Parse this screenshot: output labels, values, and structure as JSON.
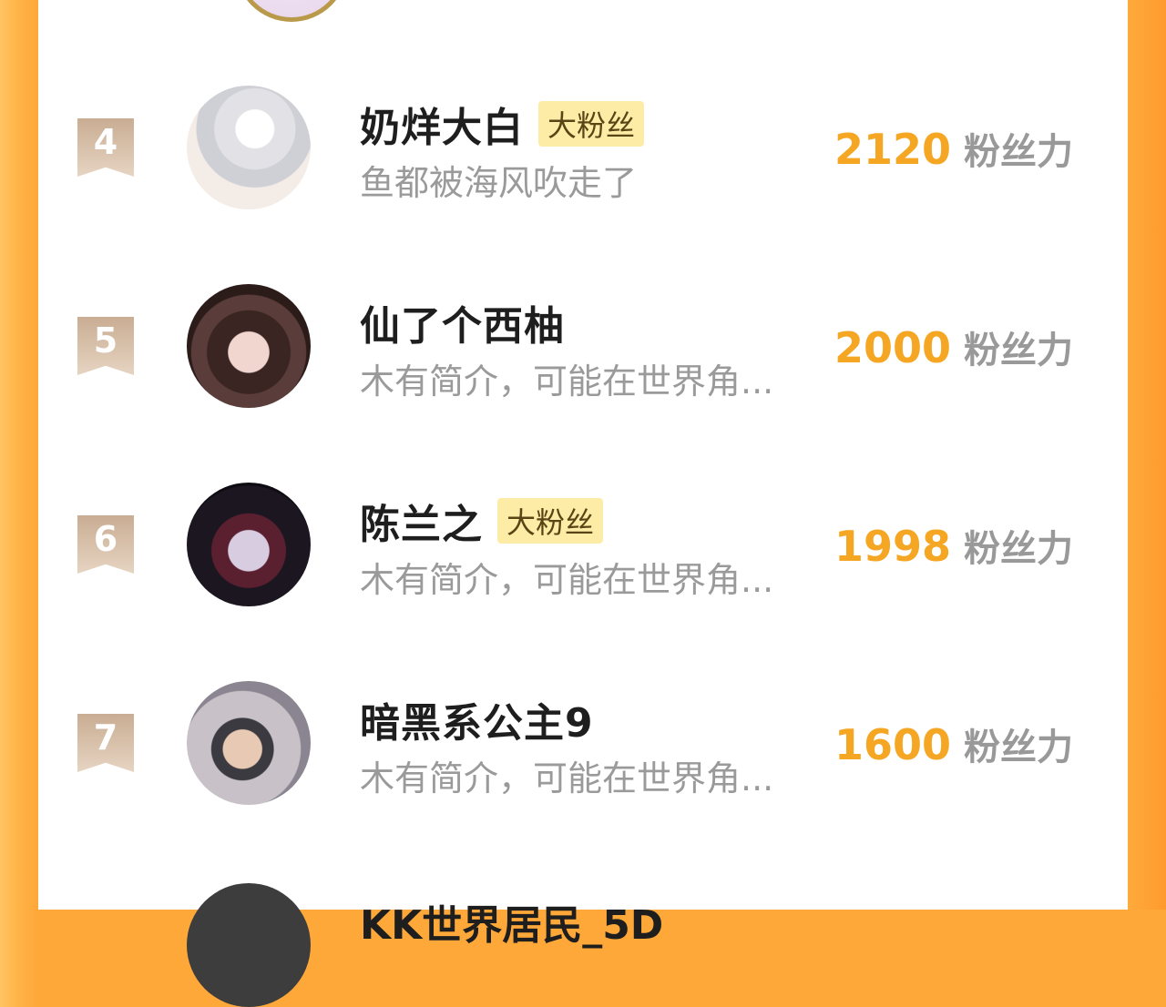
{
  "colors": {
    "accent_orange": "#f5a623",
    "background_orange": "#ffa83a",
    "rank_badge": "#d8c0a9",
    "fan_badge": "#fdeca6"
  },
  "score_unit": "粉丝力",
  "rows": [
    {
      "rank": "4",
      "name": "奶烊大白",
      "badge": "大粉丝",
      "bio": "鱼都被海风吹走了",
      "score": "2120",
      "avatar_icon": "anime-character-avatar-icon"
    },
    {
      "rank": "5",
      "name": "仙了个西柚",
      "badge": "",
      "bio": "木有简介，可能在世界角...",
      "score": "2000",
      "avatar_icon": "user-photo-avatar-icon"
    },
    {
      "rank": "6",
      "name": "陈兰之",
      "badge": "大粉丝",
      "bio": "木有简介，可能在世界角...",
      "score": "1998",
      "avatar_icon": "anime-character-avatar-icon"
    },
    {
      "rank": "7",
      "name": "暗黑系公主9",
      "badge": "",
      "bio": "木有简介，可能在世界角...",
      "score": "1600",
      "avatar_icon": "user-photo-avatar-icon"
    }
  ],
  "partial_next": {
    "name": "KK世界居民_5D"
  }
}
